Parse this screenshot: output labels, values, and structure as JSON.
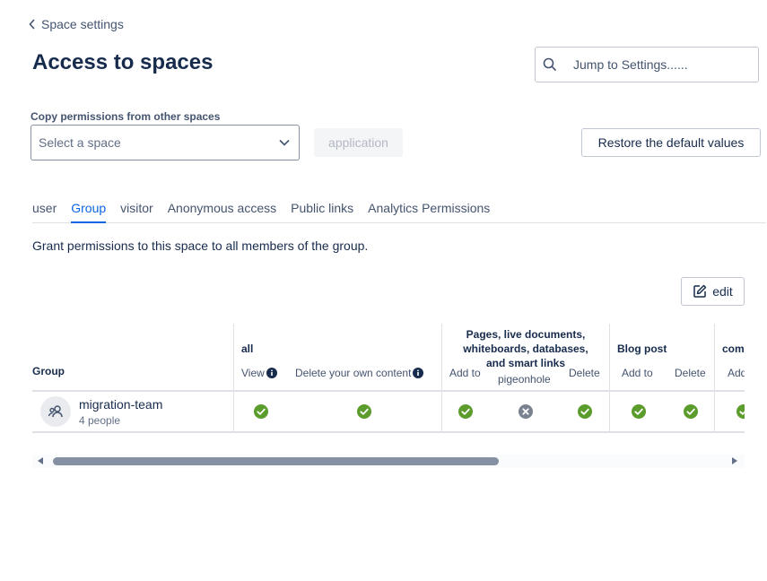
{
  "nav": {
    "back_label": "Space settings"
  },
  "header": {
    "title": "Access to spaces",
    "search_placeholder": "Jump to Settings......"
  },
  "copy": {
    "label": "Copy permissions from other spaces",
    "select_placeholder": "Select a space",
    "apply_label": "application",
    "restore_label": "Restore the default values"
  },
  "tabs": [
    {
      "label": "user",
      "active": false
    },
    {
      "label": "Group",
      "active": true
    },
    {
      "label": "visitor",
      "active": false
    },
    {
      "label": "Anonymous access",
      "active": false
    },
    {
      "label": "Public links",
      "active": false
    },
    {
      "label": "Analytics Permissions",
      "active": false
    }
  ],
  "description": "Grant permissions to this space to all members of the group.",
  "edit_label": "edit",
  "table": {
    "group_header": "Group",
    "group_all": "all",
    "all_cols": {
      "view": "View",
      "delete_own": "Delete your own content"
    },
    "group_pages": "Pages, live documents,\nwhiteboards, databases,\nand smart links",
    "pages_cols": {
      "add": "Add to",
      "pigeonhole": "pigeonhole",
      "delete": "Delete"
    },
    "group_blog": "Blog post",
    "blog_cols": {
      "add": "Add to",
      "delete": "Delete"
    },
    "group_comments": "com",
    "comments_cols": {
      "add": "Add"
    },
    "row": {
      "name": "migration-team",
      "count": "4 people",
      "permissions": {
        "view": "granted",
        "delete_own": "granted",
        "pages_add": "granted",
        "pages_pigeonhole": "denied",
        "pages_delete": "granted",
        "blog_add": "granted",
        "blog_delete": "granted",
        "comments_add": "granted"
      }
    }
  },
  "scroll_position": 0.0,
  "colors": {
    "granted": "#5b9c2d",
    "denied": "#7a8290",
    "accent": "#0c66e4"
  }
}
